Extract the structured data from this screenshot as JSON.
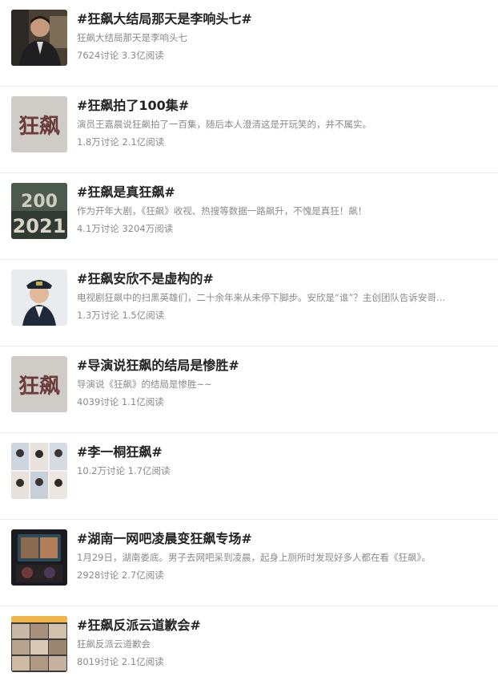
{
  "topics": [
    {
      "title": "#狂飙大结局那天是李响头七#",
      "desc": "狂飙大结局那天是李响头七",
      "stats": "7624讨论 3.3亿阅读",
      "thumb": "man-portrait-thumbnail"
    },
    {
      "title": "#狂飙拍了100集#",
      "desc": "演员王嘉晨说狂飙拍了一百集，随后本人澄清这是开玩笑的，并不属实。",
      "stats": "1.8万讨论 2.1亿阅读",
      "thumb": "kuangbiao-calligraphy-thumbnail",
      "thumb_text": "狂飙"
    },
    {
      "title": "#狂飙是真狂飙#",
      "desc": "作为开年大剧，《狂飙》收视、热搜等数据一路飙升，不愧是真狂！飙！",
      "stats": "4.1万讨论 3204万阅读",
      "thumb": "year-numbers-thumbnail",
      "thumb_text": "2021"
    },
    {
      "title": "#狂飙安欣不是虚构的#",
      "desc": "电视剧狂飙中的扫黑英雄们，二十余年来从未停下脚步。安欣是“谁”？主创团队告诉安哥…",
      "stats": "1.3万讨论 1.5亿阅读",
      "thumb": "police-officer-thumbnail"
    },
    {
      "title": "#导演说狂飙的结局是惨胜#",
      "desc": "导演说《狂飙》的结局是惨胜~~",
      "stats": "4039讨论 1.1亿阅读",
      "thumb": "kuangbiao-calligraphy-thumbnail",
      "thumb_text": "狂飙"
    },
    {
      "title": "#李一桐狂飙#",
      "desc": "",
      "stats": "10.2万讨论 1.7亿阅读",
      "thumb": "photo-collage-thumbnail"
    },
    {
      "title": "#湖南一网吧凌晨变狂飙专场#",
      "desc": "1月29日，湖南娄底。男子去网吧呆到凌晨，起身上厕所时发现好多人都在看《狂飙》。",
      "stats": "2928讨论 2.7亿阅读",
      "thumb": "internet-cafe-screen-thumbnail"
    },
    {
      "title": "#狂飙反派云道歉会#",
      "desc": "狂飙反派云道歉会",
      "stats": "8019讨论 2.1亿阅读",
      "thumb": "video-call-grid-thumbnail"
    }
  ],
  "colors": {
    "title": "#222222",
    "meta": "#8a8a8a",
    "divider": "#ececec"
  }
}
